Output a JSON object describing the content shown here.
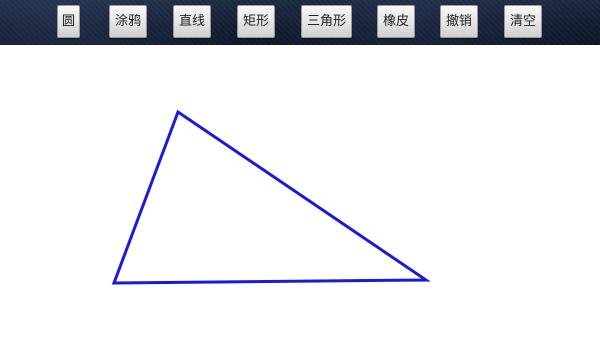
{
  "toolbar": {
    "buttons": [
      {
        "id": "circle",
        "label": "圆"
      },
      {
        "id": "doodle",
        "label": "涂鸦"
      },
      {
        "id": "line",
        "label": "直线"
      },
      {
        "id": "rect",
        "label": "矩形"
      },
      {
        "id": "triangle",
        "label": "三角形"
      },
      {
        "id": "eraser",
        "label": "橡皮"
      },
      {
        "id": "undo",
        "label": "撤销"
      },
      {
        "id": "clear",
        "label": "清空"
      }
    ]
  },
  "canvas": {
    "background_color": "#ffffff",
    "shapes": [
      {
        "type": "triangle",
        "stroke_color": "#1a1adb"
      }
    ]
  }
}
